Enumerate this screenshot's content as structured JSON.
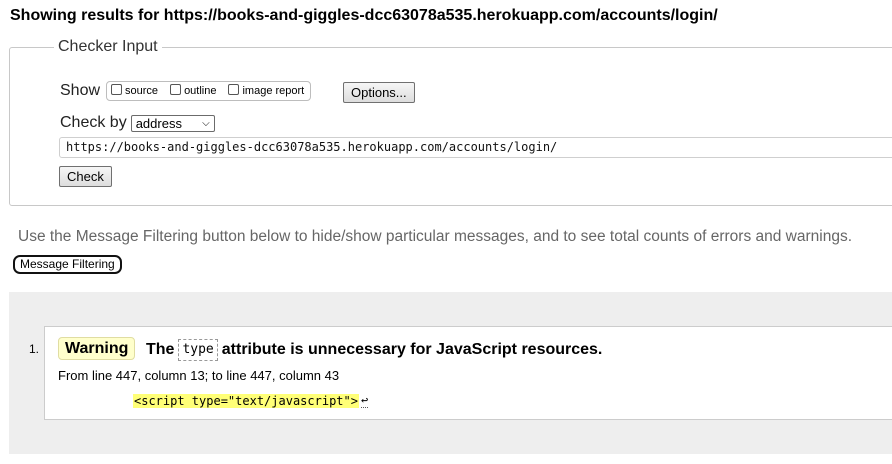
{
  "heading": "Showing results for https://books-and-giggles-dcc63078a535.herokuapp.com/accounts/login/",
  "checker": {
    "legend": "Checker Input",
    "show_label": "Show",
    "show_options": [
      "source",
      "outline",
      "image report"
    ],
    "options_button": "Options...",
    "check_by_label": "Check by",
    "check_by_value": "address",
    "url_value": "https://books-and-giggles-dcc63078a535.herokuapp.com/accounts/login/",
    "check_button": "Check"
  },
  "filtering": {
    "info": "Use the Message Filtering button below to hide/show particular messages, and to see total counts of errors and warnings.",
    "button": "Message Filtering"
  },
  "messages": [
    {
      "number": "1.",
      "type": "Warning",
      "title_pre": "The",
      "title_code": "type",
      "title_post": "attribute is unnecessary for JavaScript resources.",
      "location": "From line 447, column 13; to line 447, column 43",
      "extract": "<script type=\"text/javascript\">",
      "extract_suffix": "↩"
    }
  ]
}
